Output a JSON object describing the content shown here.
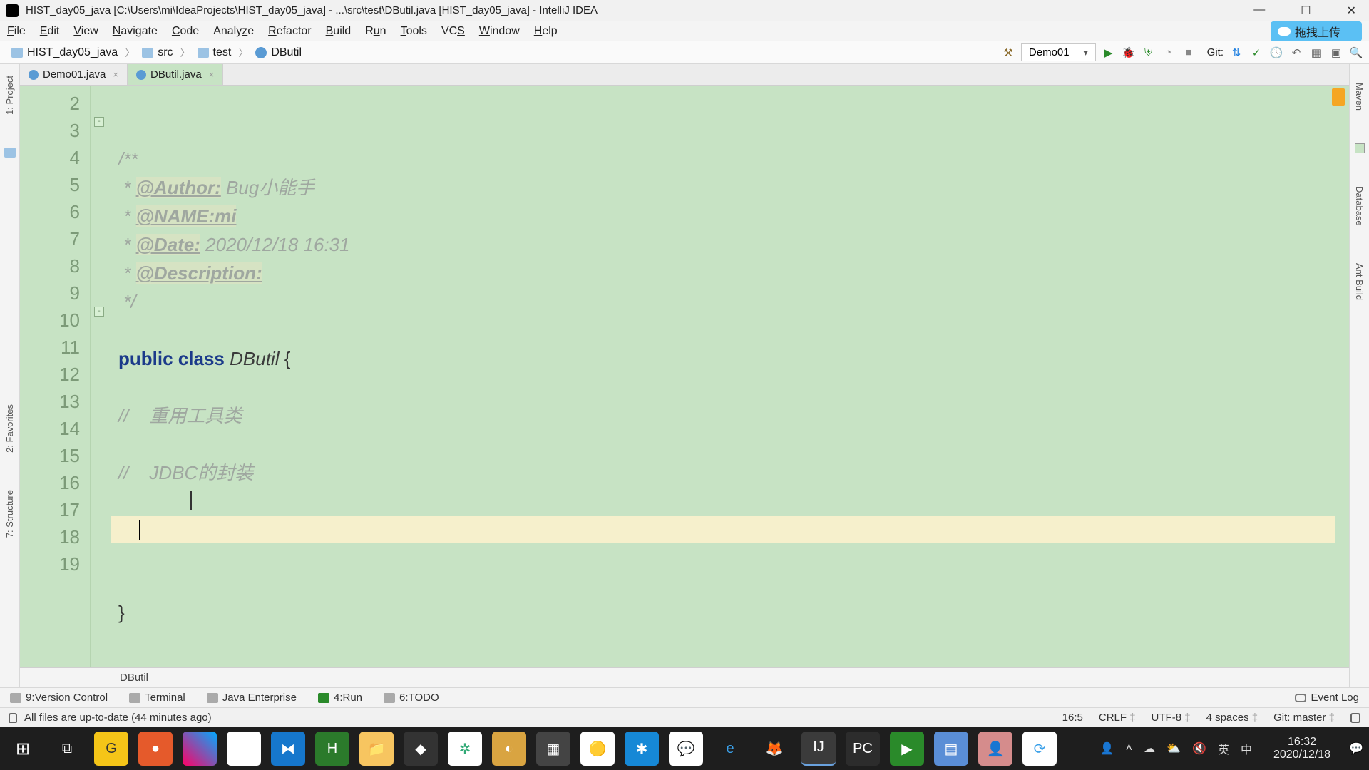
{
  "title": "HIST_day05_java [C:\\Users\\mi\\IdeaProjects\\HIST_day05_java] - ...\\src\\test\\DButil.java [HIST_day05_java] - IntelliJ IDEA",
  "menu": [
    "File",
    "Edit",
    "View",
    "Navigate",
    "Code",
    "Analyze",
    "Refactor",
    "Build",
    "Run",
    "Tools",
    "VCS",
    "Window",
    "Help"
  ],
  "cloud_label": "拖拽上传",
  "breadcrumb": [
    {
      "icon": "folder",
      "text": "HIST_day05_java"
    },
    {
      "icon": "folder",
      "text": "src"
    },
    {
      "icon": "folder",
      "text": "test"
    },
    {
      "icon": "class",
      "text": "DButil"
    }
  ],
  "run_config": "Demo01",
  "git_label": "Git:",
  "tabs": [
    {
      "name": "Demo01.java",
      "active": false
    },
    {
      "name": "DButil.java",
      "active": true
    }
  ],
  "gutter_lines": [
    "2",
    "3",
    "4",
    "5",
    "6",
    "7",
    "8",
    "9",
    "10",
    "11",
    "12",
    "13",
    "14",
    "15",
    "16",
    "17",
    "18",
    "19"
  ],
  "code": {
    "l3": "/**",
    "l4_pre": " * ",
    "l4_tag": "@Author:",
    "l4_rest": " Bug小能手",
    "l5_pre": " * ",
    "l5_tag": "@NAME:mi",
    "l6_pre": " * ",
    "l6_tag": "@Date:",
    "l6_rest": " 2020/12/18 16:31",
    "l7_pre": " * ",
    "l7_tag": "@Description:",
    "l8": " */",
    "l10_kw1": "public",
    "l10_kw2": "class",
    "l10_cls": "DButil",
    "l10_brace": " {",
    "l12": "//    重用工具类",
    "l14": "//    JDBC的封装",
    "l18": "}"
  },
  "editor_crumb": "DButil",
  "left_tools": [
    "1: Project"
  ],
  "right_tools": [
    "Maven",
    "Database",
    "Ant Build"
  ],
  "bottom_tools": [
    {
      "key": "9",
      "label": "Version Control"
    },
    {
      "key": "",
      "label": "Terminal"
    },
    {
      "key": "",
      "label": "Java Enterprise"
    },
    {
      "key": "4",
      "label": "Run"
    },
    {
      "key": "6",
      "label": "TODO"
    }
  ],
  "event_log": "Event Log",
  "status_msg": "All files are up-to-date (44 minutes ago)",
  "status_right": {
    "pos": "16:5",
    "sep": "CRLF",
    "enc": "UTF-8",
    "indent": "4 spaces",
    "git": "Git: master"
  },
  "side_left_extra": [
    "2: Favorites",
    "7: Structure"
  ],
  "tray": {
    "time": "16:32",
    "date": "2020/12/18"
  }
}
